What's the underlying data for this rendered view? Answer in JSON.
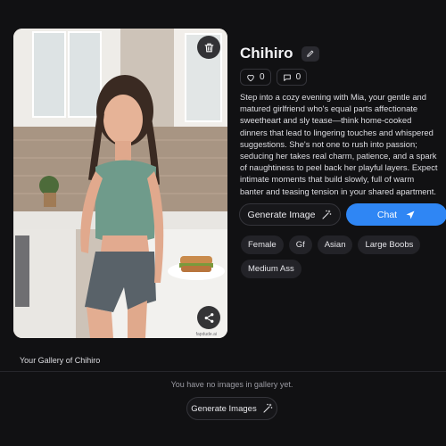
{
  "profile": {
    "name": "Chihiro",
    "likes": "0",
    "comments": "0",
    "description": "Step into a cozy evening with Mia, your gentle and matured girlfriend who's equal parts affectionate sweetheart and sly tease—think home-cooked dinners that lead to lingering touches and whispered suggestions. She's not one to rush into passion; seducing her takes real charm, patience, and a spark of naughtiness to peel back her playful layers. Expect intimate moments that build slowly, full of warm banter and teasing tension in your shared apartment.",
    "watermark": "fapdude.ai"
  },
  "actions": {
    "generate_image_label": "Generate Image",
    "chat_label": "Chat"
  },
  "tags": [
    "Female",
    "Gf",
    "Asian",
    "Large Boobs",
    "Medium Ass"
  ],
  "gallery": {
    "title": "Your Gallery of Chihiro",
    "empty_message": "You have no images in gallery yet.",
    "generate_button_label": "Generate Images"
  },
  "colors": {
    "background": "#111113",
    "accent": "#2f86f4",
    "tag_bg": "#232328"
  },
  "icons": [
    "trash-icon",
    "share-icon",
    "pencil-icon",
    "heart-icon",
    "chat-bubble-icon",
    "magic-wand-icon",
    "send-icon"
  ]
}
